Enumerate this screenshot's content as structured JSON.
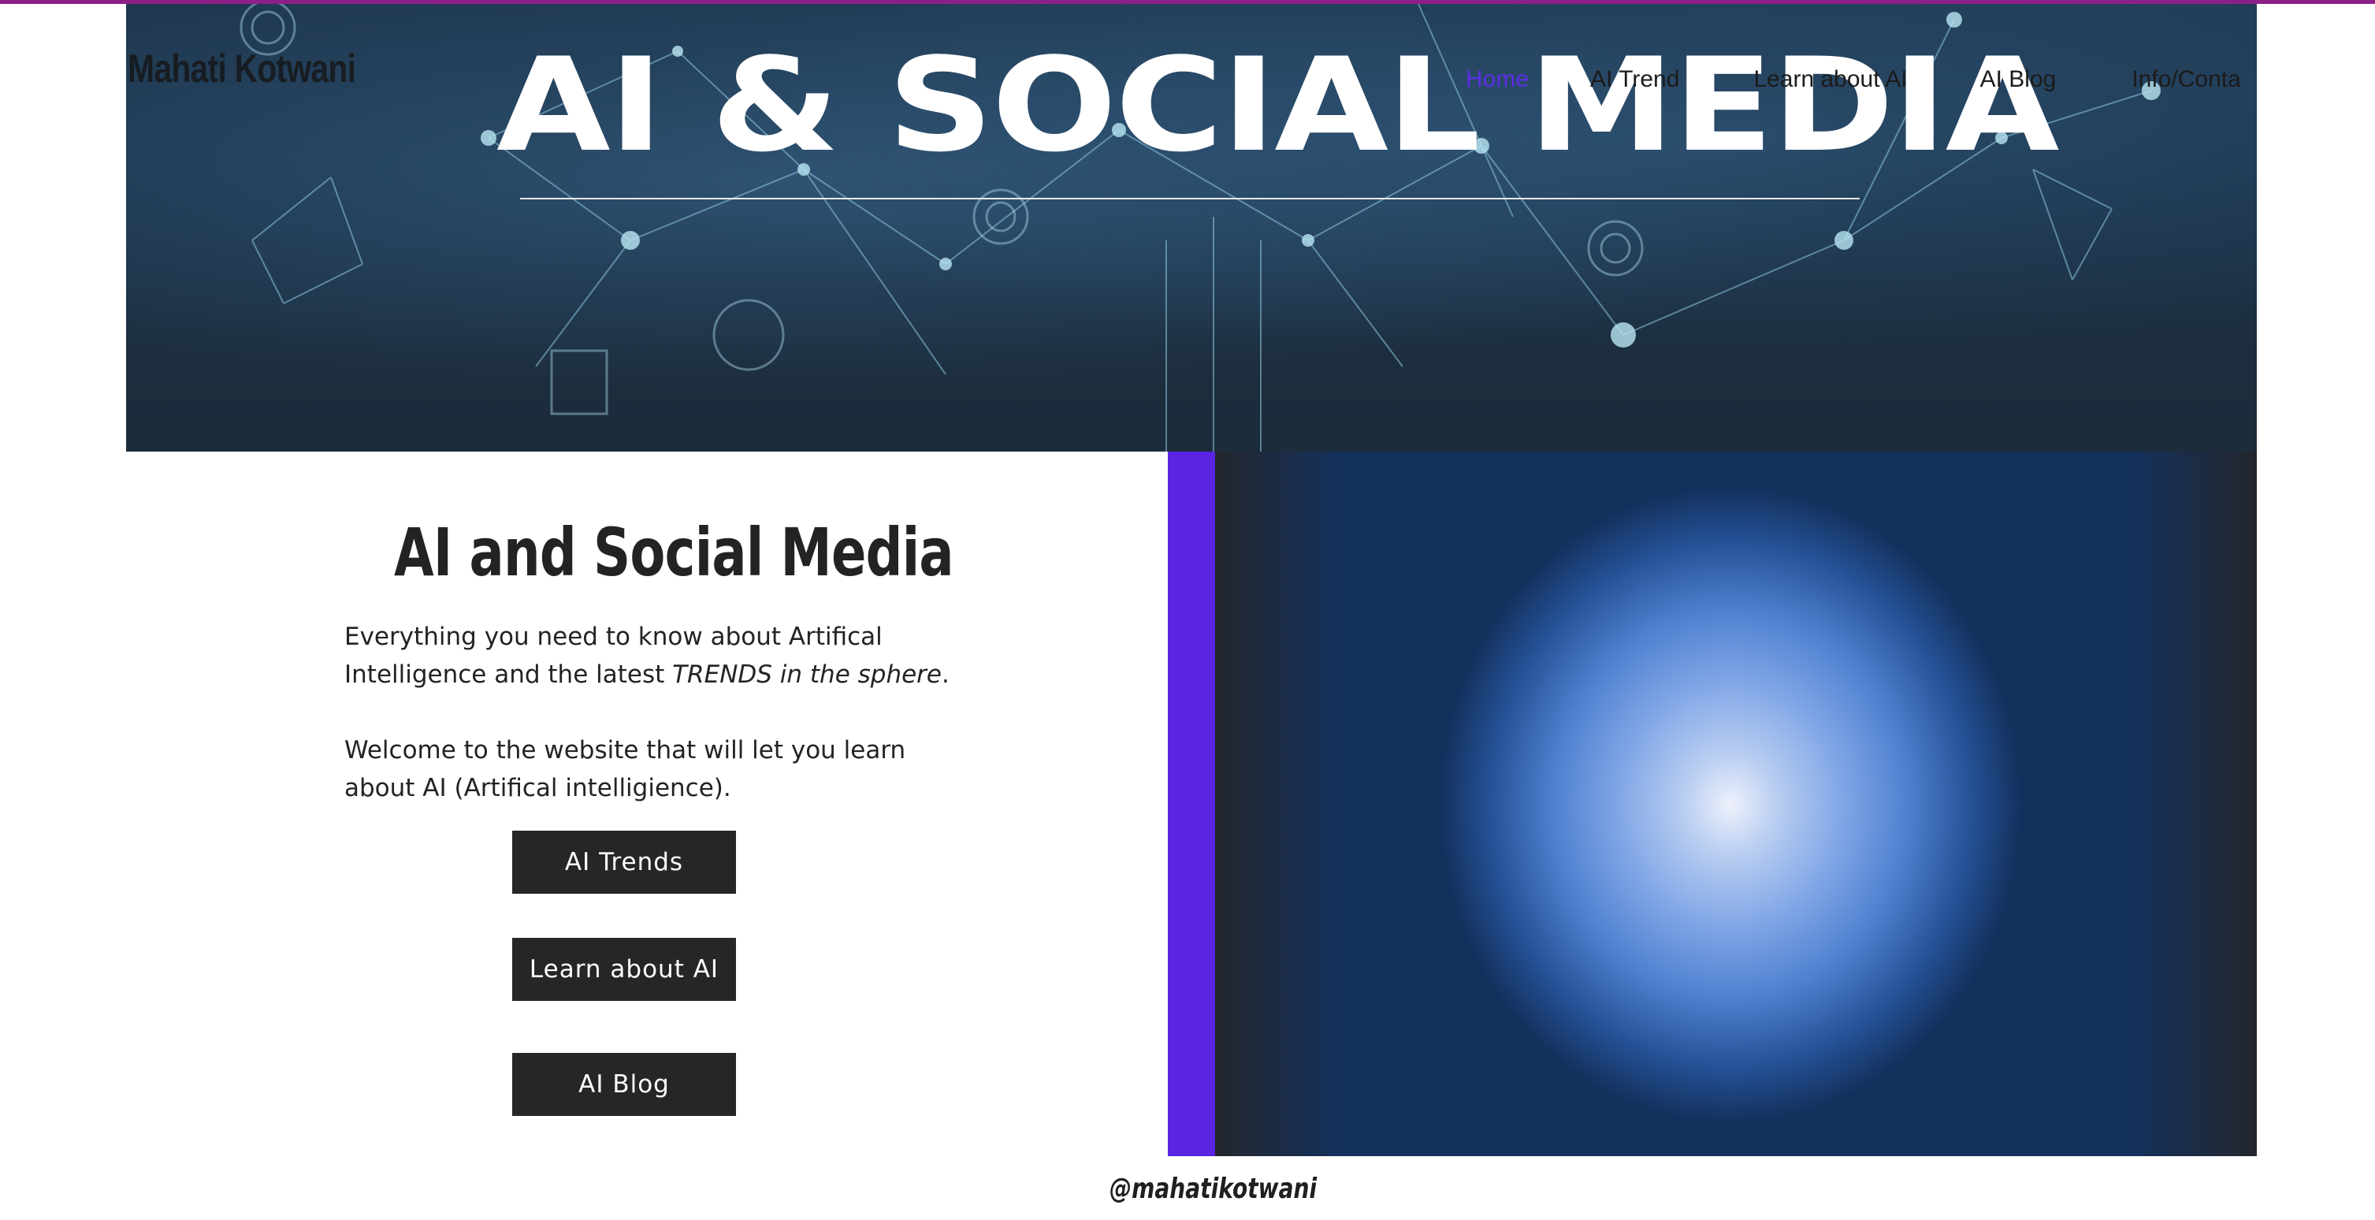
{
  "site": {
    "name": "Mahati Kotwani",
    "hero_title": "AI & SOCIAL MEDIA"
  },
  "nav": {
    "items": [
      {
        "label": "Home",
        "active": true
      },
      {
        "label": "AI Trend",
        "active": false
      },
      {
        "label": "Learn about AI",
        "active": false
      },
      {
        "label": "AI Blog",
        "active": false
      },
      {
        "label": "Info/Conta",
        "active": false
      }
    ]
  },
  "intro": {
    "heading": "AI and Social Media",
    "paragraph1_plain": "Everything you need to know about Artifical Intelligence and the latest ",
    "paragraph1_italic": "TRENDS in the sphere",
    "paragraph1_end": ".",
    "paragraph2": "Welcome to the website that will let you learn about AI (Artifical intelligience)."
  },
  "buttons": {
    "trends": "AI Trends",
    "learn": "Learn about AI",
    "blog": "AI Blog"
  },
  "footer": {
    "handle": "@mahatikotwani"
  },
  "colors": {
    "accent_purple": "#5a24e3",
    "active_nav": "#5c2ee6",
    "top_line": "#8e1f88",
    "button_bg": "#262626"
  }
}
